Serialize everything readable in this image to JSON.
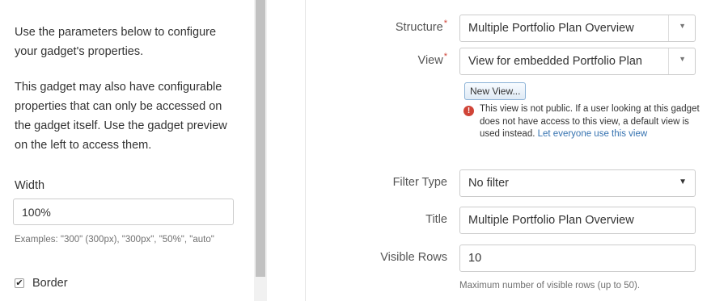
{
  "left_panel": {
    "intro": "Use the parameters below to configure your gadget's properties.",
    "note": "This gadget may also have configurable properties that can only be accessed on the gadget itself. Use the gadget preview on the left to access them.",
    "width": {
      "label": "Width",
      "value": "100%",
      "examples": "Examples: \"300\" (300px), \"300px\", \"50%\", \"auto\""
    },
    "border": {
      "label": "Border",
      "checked": true,
      "check_glyph": "✔"
    }
  },
  "form": {
    "required_mark": "*",
    "structure": {
      "label": "Structure",
      "value": "Multiple Portfolio Plan Overview",
      "caret": "▼"
    },
    "view": {
      "label": "View",
      "value": "View for embedded Portfolio Plan",
      "caret": "▼",
      "new_view_button": "New View...",
      "warning_icon": "!",
      "warning_text": "This view is not public. If a user looking at this gadget does not have access to this view, a default view is used instead.",
      "warning_link": "Let everyone use this view"
    },
    "filter_type": {
      "label": "Filter Type",
      "value": "No filter",
      "caret": "▼"
    },
    "title": {
      "label": "Title",
      "value": "Multiple Portfolio Plan Overview"
    },
    "visible_rows": {
      "label": "Visible Rows",
      "value": "10",
      "hint": "Maximum number of visible rows (up to 50)."
    }
  },
  "colors": {
    "required": "#d04437",
    "link": "#3572b0",
    "warning": "#d04437"
  }
}
